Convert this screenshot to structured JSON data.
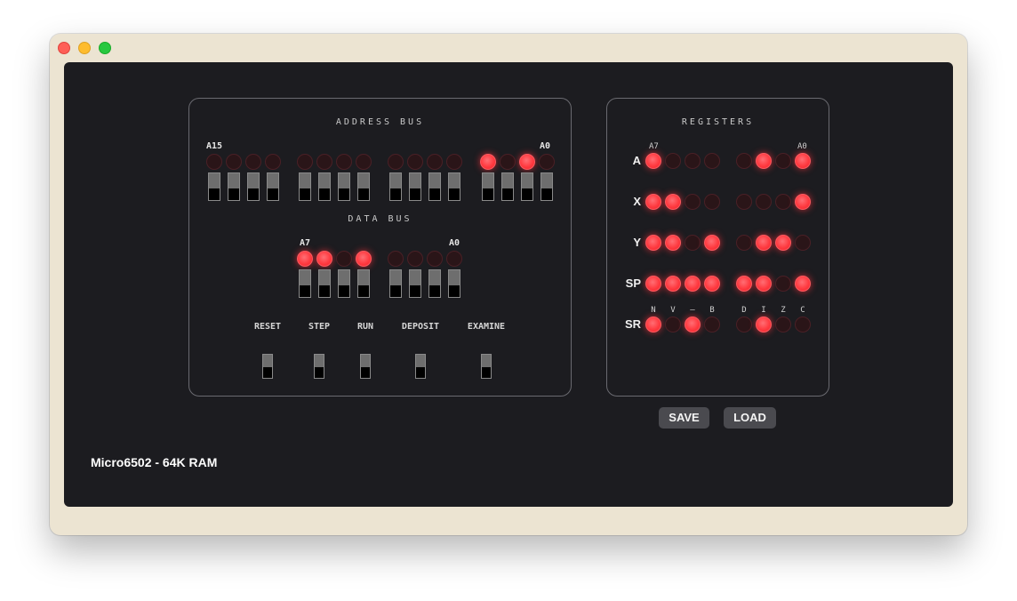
{
  "address_bus": {
    "title": "ADDRESS BUS",
    "msb_label": "A15",
    "lsb_label": "A0",
    "bits": [
      0,
      0,
      0,
      0,
      0,
      0,
      0,
      0,
      0,
      0,
      0,
      0,
      1,
      0,
      1,
      0
    ]
  },
  "data_bus": {
    "title": "DATA BUS",
    "msb_label": "A7",
    "lsb_label": "A0",
    "bits": [
      1,
      1,
      0,
      1,
      0,
      0,
      0,
      0
    ]
  },
  "controls": [
    {
      "label": "RESET"
    },
    {
      "label": "STEP"
    },
    {
      "label": "RUN"
    },
    {
      "label": "DEPOSIT"
    },
    {
      "label": "EXAMINE"
    }
  ],
  "registers": {
    "title": "REGISTERS",
    "msb_label": "A7",
    "lsb_label": "A0",
    "rows": [
      {
        "name": "A",
        "bits": [
          1,
          0,
          0,
          0,
          0,
          1,
          0,
          1
        ]
      },
      {
        "name": "X",
        "bits": [
          1,
          1,
          0,
          0,
          0,
          0,
          0,
          1
        ]
      },
      {
        "name": "Y",
        "bits": [
          1,
          1,
          0,
          1,
          0,
          1,
          1,
          0
        ]
      },
      {
        "name": "SP",
        "bits": [
          1,
          1,
          1,
          1,
          1,
          1,
          0,
          1
        ]
      },
      {
        "name": "SR",
        "bits": [
          1,
          0,
          1,
          0,
          0,
          1,
          0,
          0
        ]
      }
    ],
    "flag_labels": [
      "N",
      "V",
      "–",
      "B",
      "D",
      "I",
      "Z",
      "C"
    ]
  },
  "buttons": {
    "save": "SAVE",
    "load": "LOAD"
  },
  "status_text": "Micro6502 - 64K RAM",
  "colors": {
    "led_on": "#ff3b41",
    "led_off": "#2a1518",
    "screen_bg": "#1c1c20"
  }
}
